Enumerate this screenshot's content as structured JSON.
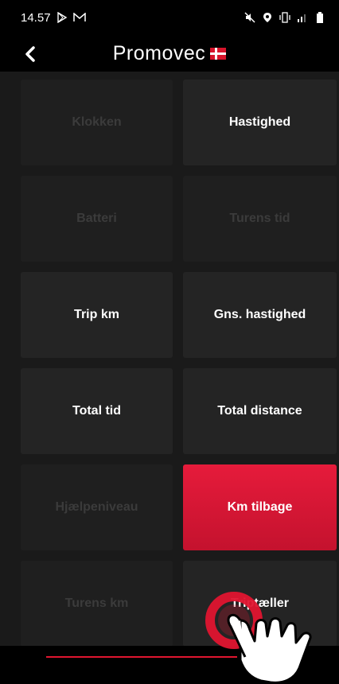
{
  "status_bar": {
    "time": "14.57",
    "left_icons": [
      "play-store-icon",
      "gmail-icon"
    ],
    "right_icons": [
      "mute-icon",
      "location-icon",
      "vibrate-icon",
      "signal-icon",
      "battery-icon"
    ]
  },
  "header": {
    "brand": "Promovec"
  },
  "tiles": [
    {
      "label": "Klokken",
      "state": "disabled"
    },
    {
      "label": "Hastighed",
      "state": "enabled"
    },
    {
      "label": "Batteri",
      "state": "disabled"
    },
    {
      "label": "Turens tid",
      "state": "disabled"
    },
    {
      "label": "Trip km",
      "state": "enabled"
    },
    {
      "label": "Gns. hastighed",
      "state": "enabled"
    },
    {
      "label": "Total tid",
      "state": "enabled"
    },
    {
      "label": "Total distance",
      "state": "enabled"
    },
    {
      "label": "Hjælpeniveau",
      "state": "disabled"
    },
    {
      "label": "Km tilbage",
      "state": "active"
    },
    {
      "label": "Turens km",
      "state": "disabled"
    },
    {
      "label": "Triptæller",
      "state": "enabled"
    }
  ],
  "colors": {
    "accent": "#e01530",
    "tile": "#242424",
    "tile_disabled": "#1f1f1f",
    "background": "#1a1a1a"
  }
}
